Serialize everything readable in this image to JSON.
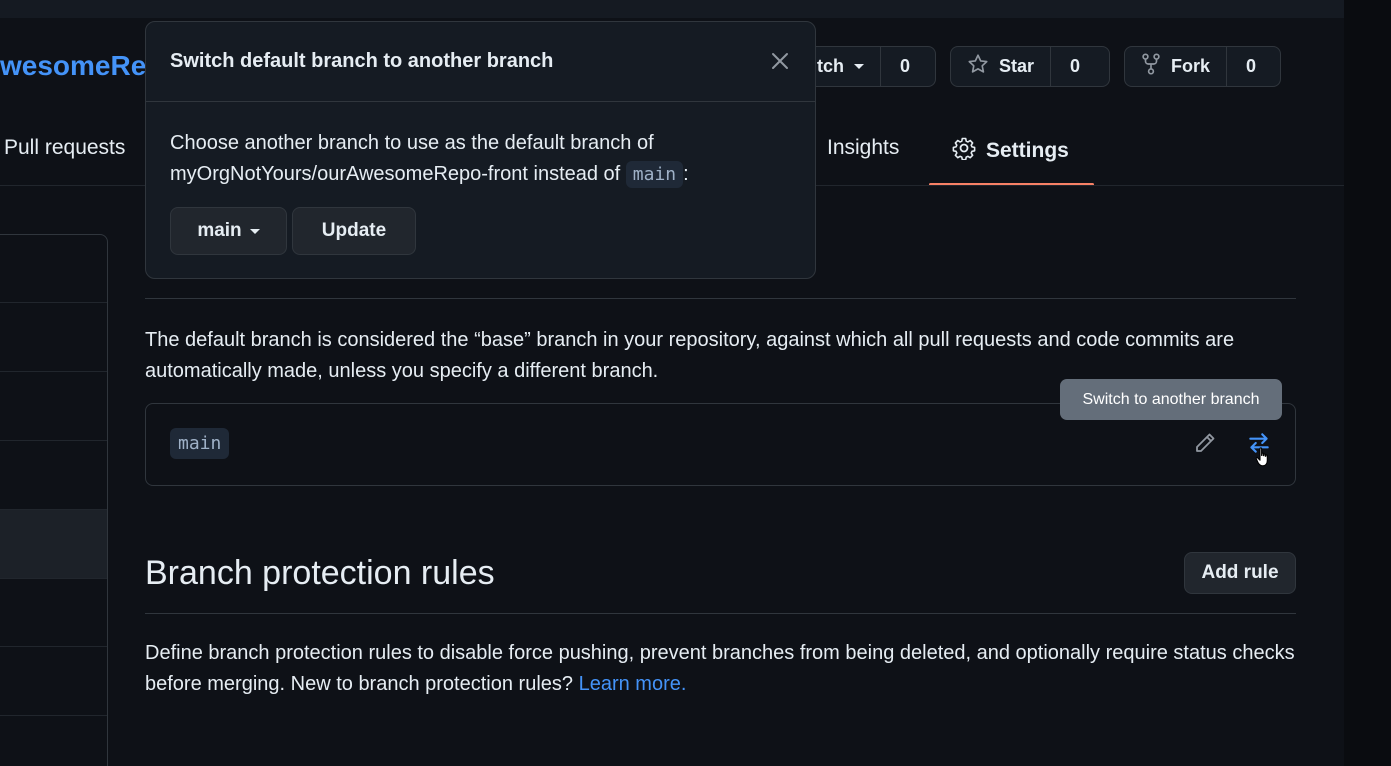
{
  "repo": {
    "name": "wesomeRe"
  },
  "actions": {
    "watch": {
      "label": "tch",
      "count": "0"
    },
    "star": {
      "label": "Star",
      "count": "0"
    },
    "fork": {
      "label": "Fork",
      "count": "0"
    }
  },
  "nav": {
    "pull_requests": "Pull requests",
    "insights": "Insights",
    "settings": "Settings"
  },
  "popover": {
    "title": "Switch default branch to another branch",
    "body_prefix": "Choose another branch to use as the default branch of myOrgNotYours/ourAwesomeRepo-front instead of",
    "current_branch": "main",
    "body_suffix": ":",
    "branch_select": "main",
    "update_button": "Update"
  },
  "default_branch": {
    "description": "The default branch is considered the “base” branch in your repository, against which all pull requests and code commits are automatically made, unless you specify a different branch.",
    "branch": "main",
    "tooltip": "Switch to another branch"
  },
  "protection": {
    "heading": "Branch protection rules",
    "add_rule": "Add rule",
    "description": "Define branch protection rules to disable force pushing, prevent branches from being deleted, and optionally require status checks before merging. New to branch protection rules?",
    "learn_more": "Learn more."
  },
  "colors": {
    "accent": "#4493f8",
    "active_tab": "#f78166",
    "background": "#0e1117"
  }
}
